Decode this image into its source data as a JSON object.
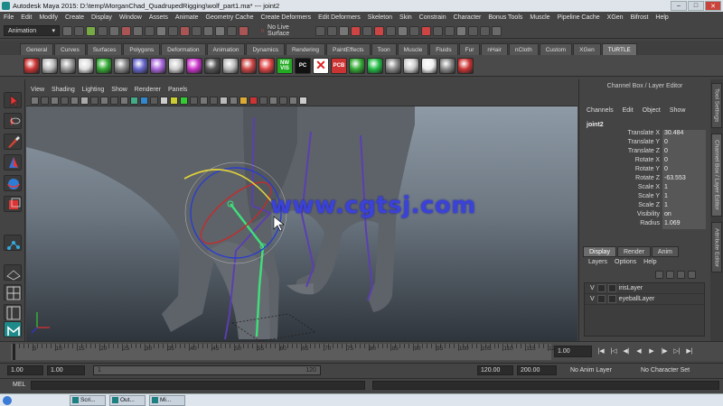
{
  "window": {
    "title": "Autodesk Maya 2015: D:\\temp\\MorganChad_QuadrupedRigging\\wolf_part1.ma*   ---   joint2",
    "controls": [
      "–",
      "□",
      "✕"
    ]
  },
  "menubar": [
    "File",
    "Edit",
    "Modify",
    "Create",
    "Display",
    "Window",
    "Assets",
    "Animate",
    "Geometry Cache",
    "Create Deformers",
    "Edit Deformers",
    "Skeleton",
    "Skin",
    "Constrain",
    "Character",
    "Bonus Tools",
    "Muscle",
    "Pipeline Cache",
    "XGen",
    "Bifrost",
    "Help"
  ],
  "statusline": {
    "menuset": "Animation",
    "live_surface": "No Live Surface"
  },
  "shelf": {
    "tabs": [
      "General",
      "Curves",
      "Surfaces",
      "Polygons",
      "Deformation",
      "Animation",
      "Dynamics",
      "Rendering",
      "PaintEffects",
      "Toon",
      "Muscle",
      "Fluids",
      "Fur",
      "nHair",
      "nCloth",
      "Custom",
      "XGen",
      "TURTLE"
    ],
    "active_tab": "TURTLE",
    "icon_labels": {
      "nw_vis": "NW\nVIS",
      "pc": "PC",
      "pcb": "PCB"
    }
  },
  "viewport": {
    "menu": [
      "View",
      "Shading",
      "Lighting",
      "Show",
      "Renderer",
      "Panels"
    ],
    "watermark": "www.cgtsj.com"
  },
  "channel_box": {
    "title": "Channel Box / Layer Editor",
    "menu": [
      "Channels",
      "Edit",
      "Object",
      "Show"
    ],
    "object": "joint2",
    "attributes": [
      {
        "name": "Translate X",
        "value": "30.484"
      },
      {
        "name": "Translate Y",
        "value": "0"
      },
      {
        "name": "Translate Z",
        "value": "0"
      },
      {
        "name": "Rotate X",
        "value": "0"
      },
      {
        "name": "Rotate Y",
        "value": "0"
      },
      {
        "name": "Rotate Z",
        "value": "-63.553"
      },
      {
        "name": "Scale X",
        "value": "1"
      },
      {
        "name": "Scale Y",
        "value": "1"
      },
      {
        "name": "Scale Z",
        "value": "1"
      },
      {
        "name": "Visibility",
        "value": "on"
      },
      {
        "name": "Radius",
        "value": "1.069"
      }
    ]
  },
  "layer_editor": {
    "tabs": [
      "Display",
      "Render",
      "Anim"
    ],
    "active_tab": "Display",
    "menu": [
      "Layers",
      "Options",
      "Help"
    ],
    "layers": [
      {
        "visible": "V",
        "name": "irisLayer"
      },
      {
        "visible": "V",
        "name": "eyeballLayer"
      }
    ]
  },
  "side_tabs": [
    "Tool Settings",
    "Channel Box / Layer Editor",
    "Attribute Editor"
  ],
  "timeline": {
    "ticks": [
      "5",
      "10",
      "15",
      "20",
      "25",
      "30",
      "35",
      "40",
      "45",
      "50",
      "55",
      "60",
      "65",
      "70",
      "75",
      "80",
      "85",
      "90",
      "95",
      "100",
      "105",
      "110",
      "115",
      "120"
    ],
    "current_frame": "1.00"
  },
  "range": {
    "start": "1.00",
    "playback_start": "1.00",
    "slider_start": "1",
    "slider_end": "120",
    "playback_end": "120.00",
    "end": "200.00",
    "anim_layer": "No Anim Layer",
    "character_set": "No Character Set"
  },
  "command_line": {
    "label": "MEL"
  },
  "taskbar": [
    "Scri...",
    "Out...",
    "Mi..."
  ],
  "colors": {
    "watermark": "#3b42d8",
    "joint_selected": "#3fe07a",
    "joint": "#5a3fb0"
  }
}
